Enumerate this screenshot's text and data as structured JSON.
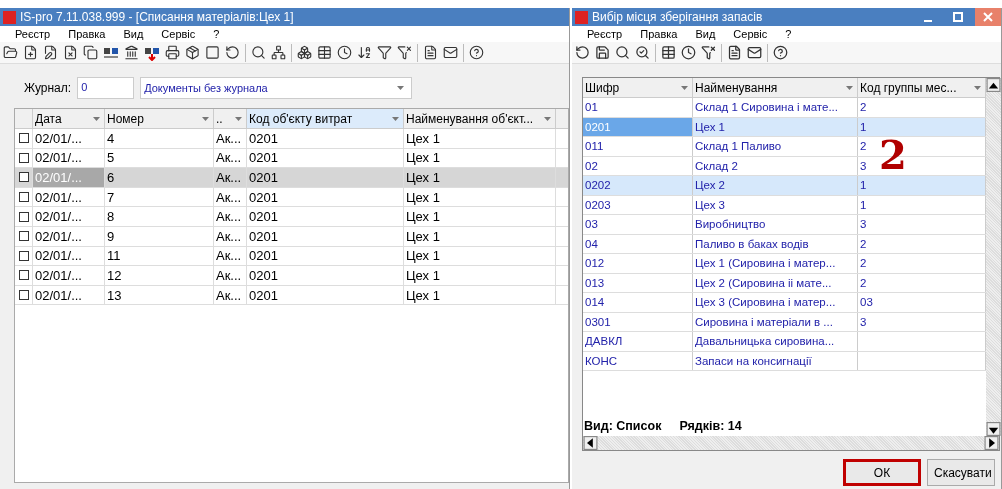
{
  "main_window": {
    "title": "IS-pro 7.11.038.999 - [Списання матеріалів:Цех 1]",
    "menu": [
      "Реєстр",
      "Правка",
      "Вид",
      "Сервіс",
      "?"
    ],
    "journal": {
      "label": "Журнал:",
      "value": "0",
      "name": "Документы без журнала"
    },
    "table": {
      "columns": [
        {
          "label": "Дата",
          "sorted": false
        },
        {
          "label": "Номер",
          "sorted": false
        },
        {
          "label": "..",
          "sorted": false
        },
        {
          "label": "Код об'єкту витрат",
          "sorted": true
        },
        {
          "label": "Найменування об'єкт...",
          "sorted": false
        }
      ],
      "rows": [
        {
          "checked": false,
          "selected": false,
          "cells": [
            "02/01/...",
            "4",
            "Ак...",
            "0201",
            "Цех 1"
          ]
        },
        {
          "checked": false,
          "selected": false,
          "cells": [
            "02/01/...",
            "5",
            "Ак...",
            "0201",
            "Цех 1"
          ]
        },
        {
          "checked": false,
          "selected": true,
          "cells": [
            "02/01/...",
            "6",
            "Ак...",
            "0201",
            "Цех 1"
          ]
        },
        {
          "checked": false,
          "selected": false,
          "cells": [
            "02/01/...",
            "7",
            "Ак...",
            "0201",
            "Цех 1"
          ]
        },
        {
          "checked": false,
          "selected": false,
          "cells": [
            "02/01/...",
            "8",
            "Ак...",
            "0201",
            "Цех 1"
          ]
        },
        {
          "checked": false,
          "selected": false,
          "cells": [
            "02/01/...",
            "9",
            "Ак...",
            "0201",
            "Цех 1"
          ]
        },
        {
          "checked": false,
          "selected": false,
          "cells": [
            "02/01/...",
            "11",
            "Ак...",
            "0201",
            "Цех 1"
          ]
        },
        {
          "checked": false,
          "selected": false,
          "cells": [
            "02/01/...",
            "12",
            "Ак...",
            "0201",
            "Цех 1"
          ]
        },
        {
          "checked": false,
          "selected": false,
          "cells": [
            "02/01/...",
            "13",
            "Ак...",
            "0201",
            "Цех 1"
          ]
        }
      ]
    }
  },
  "dialog": {
    "title": "Вибір місця зберігання запасів",
    "menu": [
      "Реєстр",
      "Правка",
      "Вид",
      "Сервіс",
      "?"
    ],
    "table": {
      "columns": [
        "Шифр",
        "Найменування",
        "Код группы мес..."
      ],
      "rows": [
        {
          "selected": false,
          "marked": false,
          "cells": [
            "01",
            "Склад 1 Сировина і мате...",
            "2"
          ]
        },
        {
          "selected": true,
          "marked": true,
          "cells": [
            "0201",
            "Цех 1",
            "1"
          ]
        },
        {
          "selected": false,
          "marked": false,
          "cells": [
            "011",
            "Склад 1 Паливо",
            "2"
          ]
        },
        {
          "selected": false,
          "marked": false,
          "cells": [
            "02",
            "Склад 2",
            "3"
          ]
        },
        {
          "selected": false,
          "marked": true,
          "cells": [
            "0202",
            "Цех 2",
            "1"
          ]
        },
        {
          "selected": false,
          "marked": false,
          "cells": [
            "0203",
            "Цех 3",
            "1"
          ]
        },
        {
          "selected": false,
          "marked": false,
          "cells": [
            "03",
            "Виробництво",
            "3"
          ]
        },
        {
          "selected": false,
          "marked": false,
          "cells": [
            "04",
            "Паливо в баках водів",
            "2"
          ]
        },
        {
          "selected": false,
          "marked": false,
          "cells": [
            "012",
            "Цех 1 (Сировина і матер...",
            "2"
          ]
        },
        {
          "selected": false,
          "marked": false,
          "cells": [
            "013",
            "Цех 2 (Сировина іі  мате...",
            "2"
          ]
        },
        {
          "selected": false,
          "marked": false,
          "cells": [
            "014",
            "Цех 3 (Сировина і матер...",
            "03"
          ]
        },
        {
          "selected": false,
          "marked": false,
          "cells": [
            "0301",
            "Сировина і матеріали в ...",
            "3"
          ]
        },
        {
          "selected": false,
          "marked": false,
          "cells": [
            "ДАВКЛ",
            "Давальницька сировина...",
            ""
          ]
        },
        {
          "selected": false,
          "marked": false,
          "cells": [
            "КОНС",
            "Запаси на консигнації",
            ""
          ]
        }
      ]
    },
    "status": [
      {
        "label": "Вид: Список"
      },
      {
        "label": "Рядків: 14"
      }
    ],
    "buttons": [
      {
        "label": "ОК",
        "highlighted": true
      },
      {
        "label": "Скасувати",
        "highlighted": false
      }
    ],
    "annotation": "2"
  }
}
